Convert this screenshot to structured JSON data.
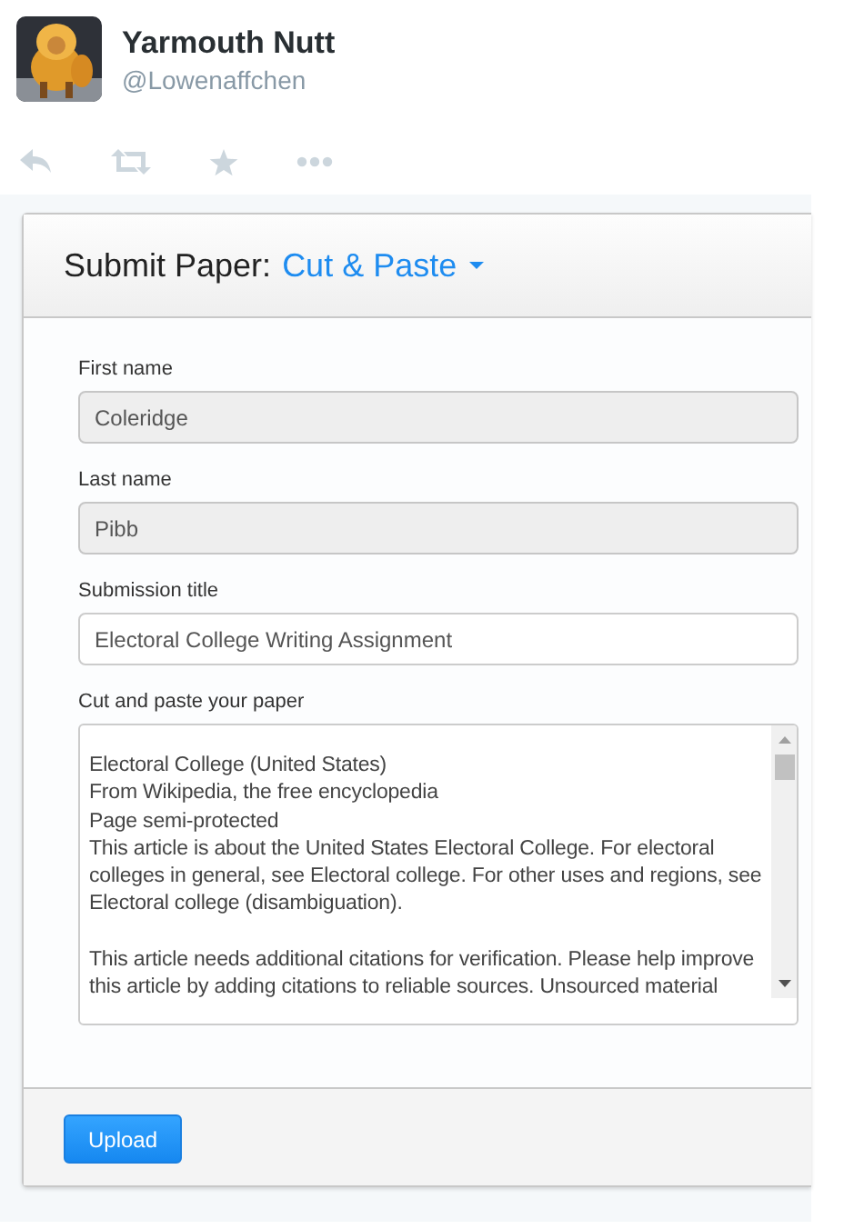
{
  "profile": {
    "name": "Yarmouth Nutt",
    "handle": "@Lowenaffchen"
  },
  "actions": [
    {
      "kind": "reply"
    },
    {
      "kind": "retweet"
    },
    {
      "kind": "favorite"
    },
    {
      "kind": "more"
    }
  ],
  "panel": {
    "title": "Submit Paper:",
    "mode": "Cut & Paste",
    "fields": [
      {
        "kind": "input",
        "label": "First name",
        "value": "Coleridge",
        "disabled": true
      },
      {
        "kind": "input",
        "label": "Last name",
        "value": "Pibb",
        "disabled": true
      },
      {
        "kind": "input",
        "label": "Submission title",
        "value": "Electoral College Writing Assignment",
        "disabled": false
      },
      {
        "kind": "textarea",
        "label": "Cut and paste your paper",
        "value": "\nElectoral College (United States)\nFrom Wikipedia, the free encyclopedia\nPage semi-protected\nThis article is about the United States Electoral College. For electoral colleges in general, see Electoral college. For other uses and regions, see Electoral college (disambiguation).\n\nThis article needs additional citations for verification. Please help improve this article by adding citations to reliable sources. Unsourced material",
        "disabled": false
      }
    ],
    "buttons": [
      "Upload"
    ]
  }
}
